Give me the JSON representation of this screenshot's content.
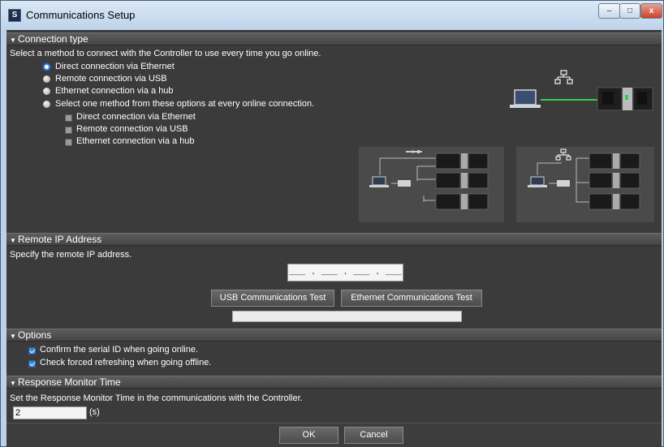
{
  "window": {
    "title": "Communications Setup",
    "controls": {
      "minimize": "–",
      "maximize": "□",
      "close": "x"
    }
  },
  "connection_type": {
    "header": "Connection type",
    "instruction": "Select a method to connect with the Controller to use every time you go online.",
    "options": [
      {
        "label": "Direct connection via Ethernet",
        "selected": true
      },
      {
        "label": "Remote connection via USB",
        "selected": false
      },
      {
        "label": "Ethernet connection via a hub",
        "selected": false
      },
      {
        "label": "Select one method from these options at every online connection.",
        "selected": false
      }
    ],
    "sub_options": [
      {
        "label": "Direct connection via Ethernet",
        "checked": false
      },
      {
        "label": "Remote connection via USB",
        "checked": false
      },
      {
        "label": "Ethernet connection via a hub",
        "checked": false
      }
    ]
  },
  "remote_ip": {
    "header": "Remote IP Address",
    "instruction": "Specify the remote IP address.",
    "ip_value": "___ . ___ . ___ . ___",
    "usb_test_label": "USB Communications Test",
    "ethernet_test_label": "Ethernet Communications Test",
    "status_text": ""
  },
  "options": {
    "header": "Options",
    "items": [
      {
        "label": "Confirm the serial ID when going online.",
        "checked": true
      },
      {
        "label": "Check forced refreshing when going offline.",
        "checked": true
      }
    ]
  },
  "response_monitor": {
    "header": "Response Monitor Time",
    "instruction": "Set the Response Monitor Time in the communications with the Controller.",
    "value": "2",
    "unit": "(s)"
  },
  "footer": {
    "ok_label": "OK",
    "cancel_label": "Cancel"
  },
  "colors": {
    "accent": "#3d86d9",
    "connection_line": "#2fd14a",
    "panel": "#3b3b3b"
  }
}
